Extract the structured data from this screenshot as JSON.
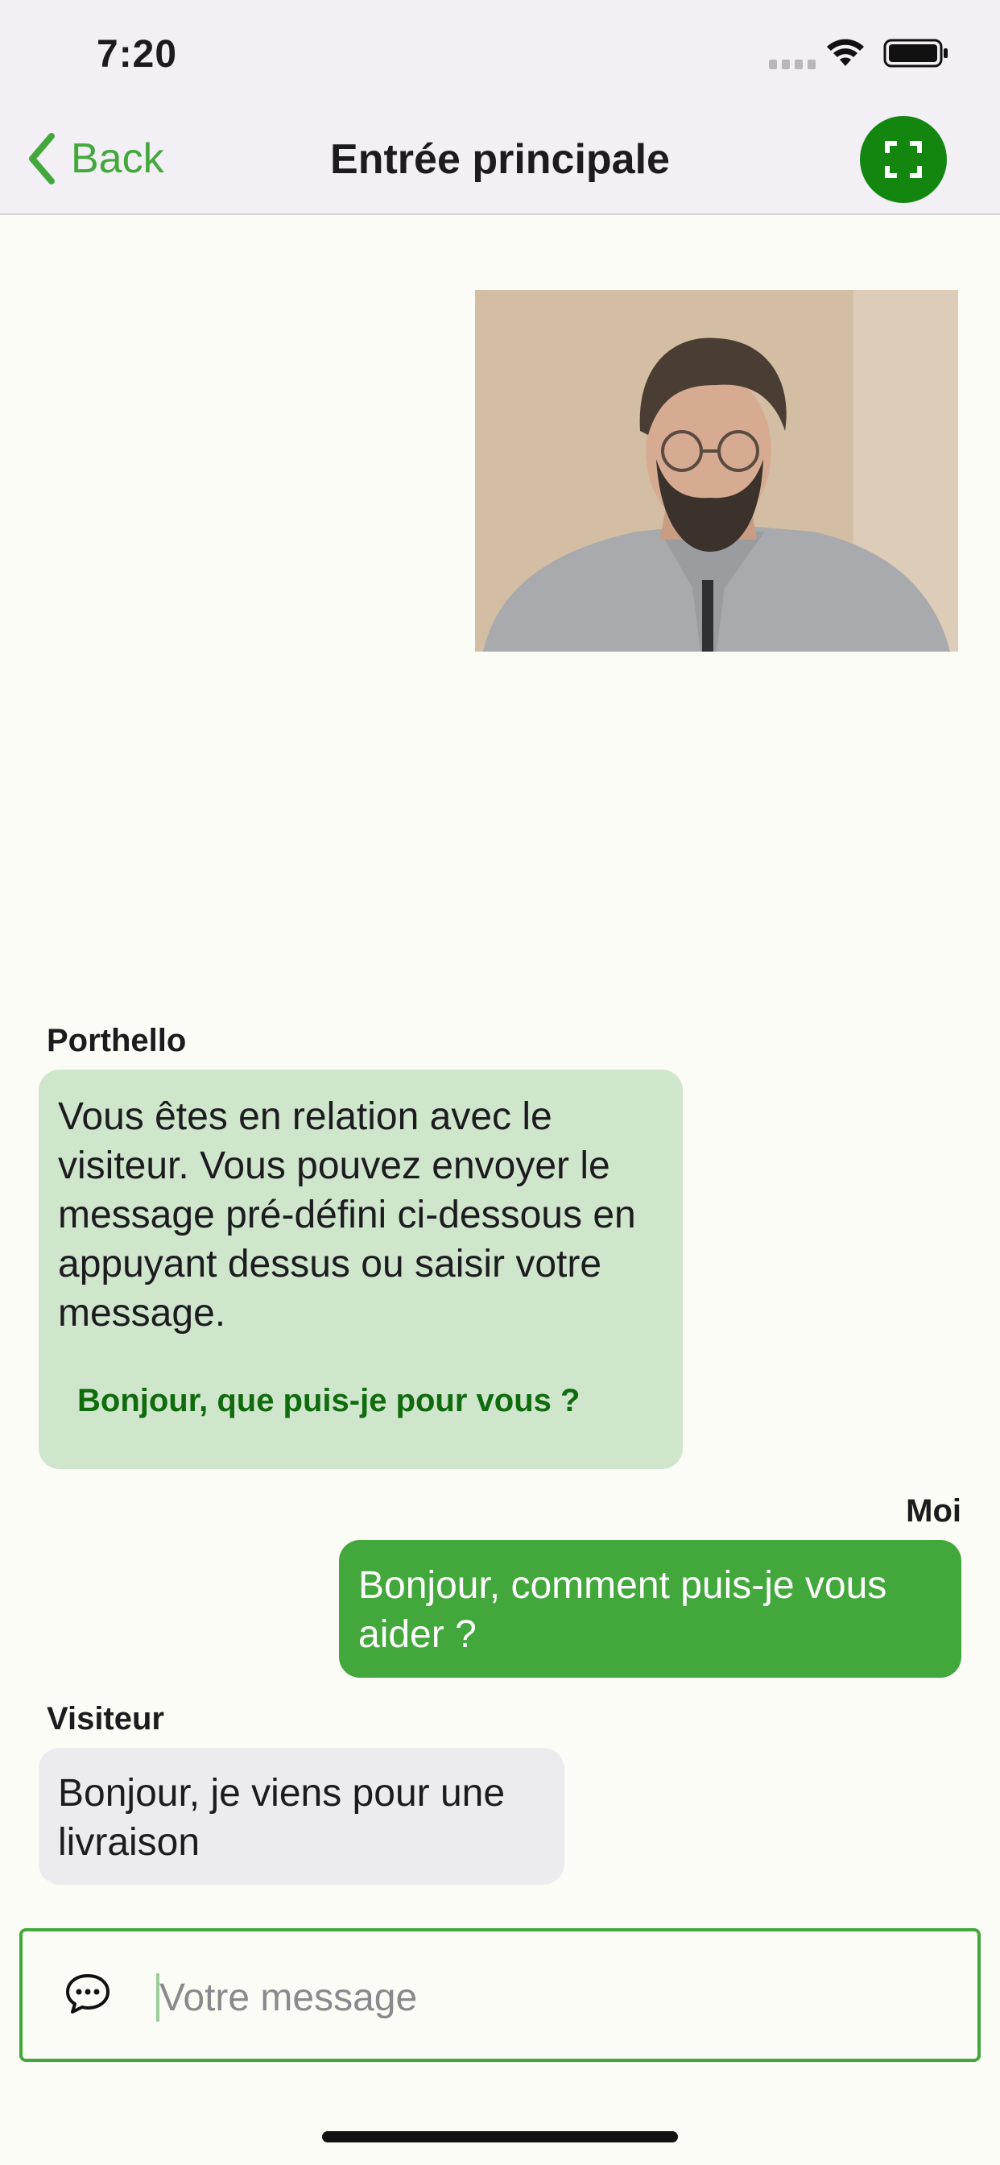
{
  "status_bar": {
    "time": "7:20"
  },
  "nav": {
    "back_label": "Back",
    "title": "Entrée principale",
    "accent": "#43a83c"
  },
  "chat": {
    "messages": [
      {
        "sender": "Porthello",
        "text": "Vous êtes en relation avec le visiteur. Vous pouvez envoyer le message pré-défini ci-dessous en appuyant dessus ou saisir votre message.",
        "quick_reply": "Bonjour, que puis-je pour vous ?",
        "bubble_color": "#cfe6cd"
      },
      {
        "sender": "Moi",
        "text": "Bonjour, comment puis-je vous aider ?",
        "bubble_color": "#43a83c"
      },
      {
        "sender": "Visiteur",
        "text": "Bonjour, je viens pour une livraison",
        "bubble_color": "#ececef"
      }
    ]
  },
  "input": {
    "placeholder": "Votre message",
    "value": ""
  },
  "icons": {
    "back": "chevron-left-icon",
    "fullscreen": "fullscreen-icon",
    "message": "chat-bubble-icon"
  }
}
